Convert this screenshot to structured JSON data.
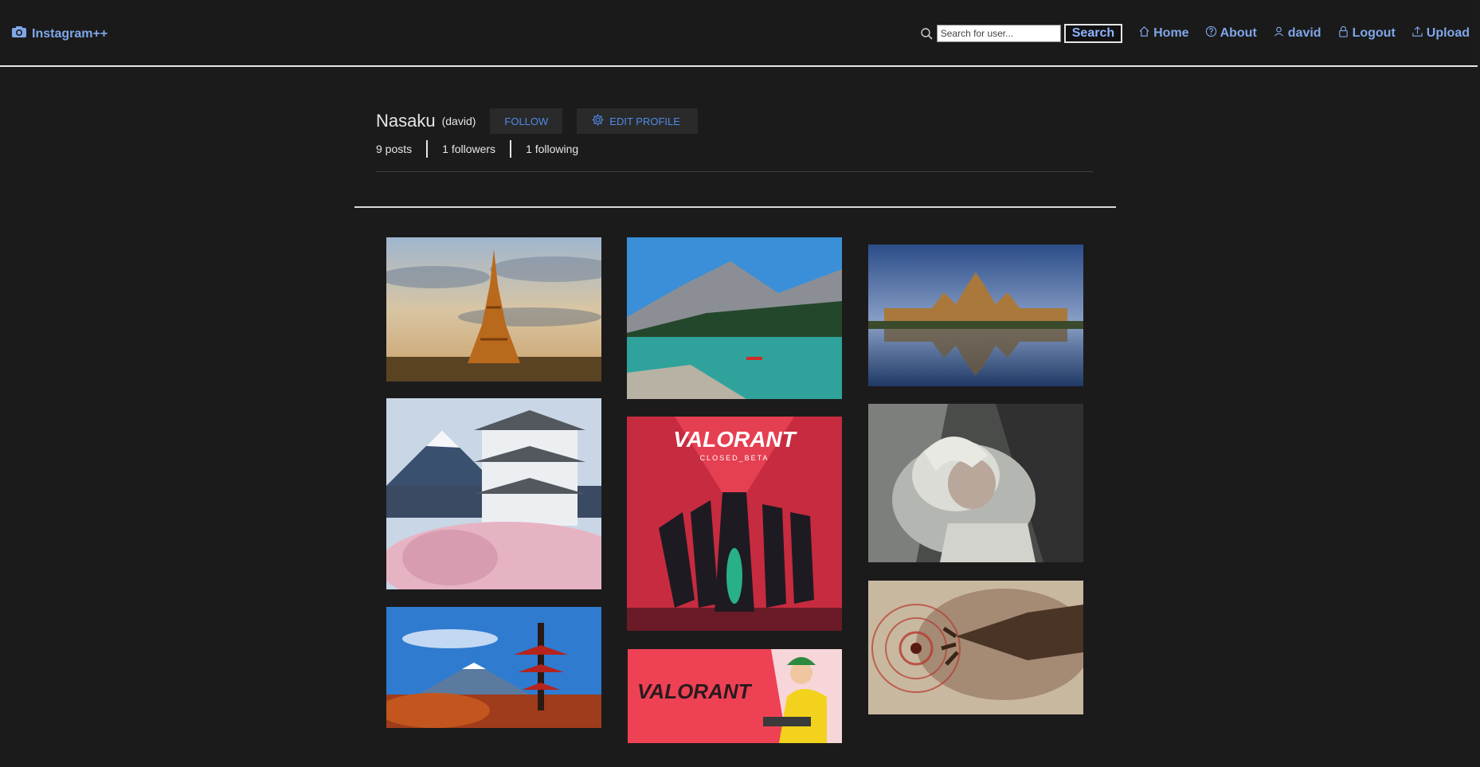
{
  "navbar": {
    "brand": "Instagram++",
    "search_placeholder": "Search for user...",
    "search_button": "Search",
    "links": {
      "home": "Home",
      "about": "About",
      "user": "david",
      "logout": "Logout",
      "upload": "Upload"
    }
  },
  "profile": {
    "display_name": "Nasaku",
    "username": "(david)",
    "follow_button": "FOLLOW",
    "edit_button": "EDIT PROFILE",
    "stats": {
      "posts": "9 posts",
      "followers": "1 followers",
      "following": "1 following"
    }
  },
  "colors": {
    "background": "#1c1b1c",
    "link": "#7fa7e8",
    "button_text": "#4f8be8"
  },
  "icons": [
    "camera-icon",
    "search-icon",
    "home-icon",
    "help-icon",
    "user-icon",
    "lock-icon",
    "upload-icon",
    "gear-icon"
  ]
}
